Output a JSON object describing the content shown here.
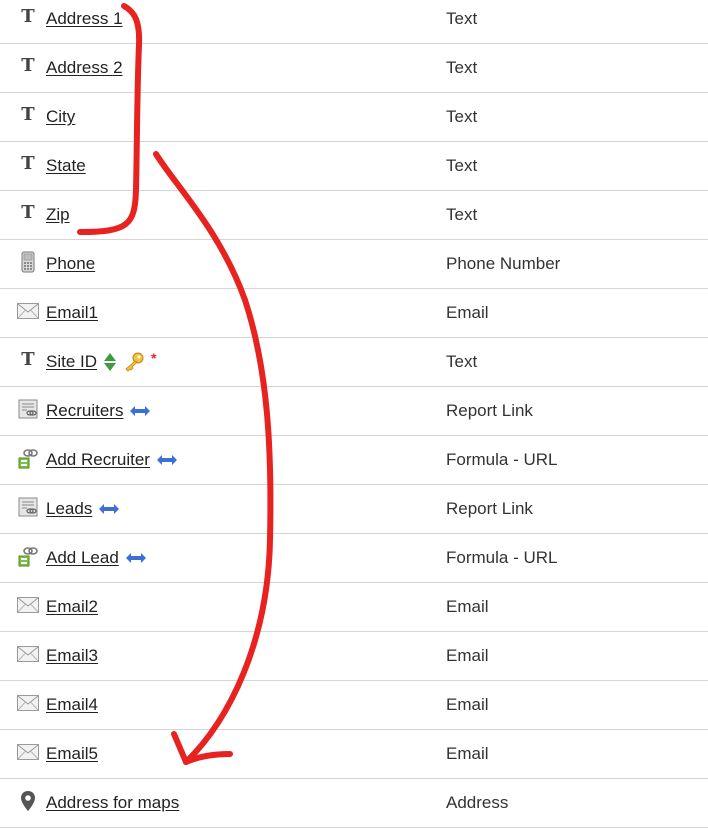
{
  "fields": [
    {
      "name": "Address 1",
      "type": "Text",
      "icon": "text-icon"
    },
    {
      "name": "Address 2",
      "type": "Text",
      "icon": "text-icon"
    },
    {
      "name": "City",
      "type": "Text",
      "icon": "text-icon"
    },
    {
      "name": "State",
      "type": "Text",
      "icon": "text-icon"
    },
    {
      "name": "Zip",
      "type": "Text",
      "icon": "text-icon"
    },
    {
      "name": "Phone",
      "type": "Phone Number",
      "icon": "phone-icon"
    },
    {
      "name": "Email1",
      "type": "Email",
      "icon": "email-icon"
    },
    {
      "name": "Site ID",
      "type": "Text",
      "icon": "text-icon",
      "badges": [
        "sort-icon",
        "key-icon",
        "required-star-icon"
      ]
    },
    {
      "name": "Recruiters",
      "type": "Report Link",
      "icon": "report-link-icon",
      "badges": [
        "two-way-link-icon"
      ]
    },
    {
      "name": "Add Recruiter",
      "type": "Formula - URL",
      "icon": "formula-url-icon",
      "badges": [
        "two-way-link-icon"
      ]
    },
    {
      "name": "Leads",
      "type": "Report Link",
      "icon": "report-link-icon",
      "badges": [
        "two-way-link-icon"
      ]
    },
    {
      "name": "Add Lead",
      "type": "Formula - URL",
      "icon": "formula-url-icon",
      "badges": [
        "two-way-link-icon"
      ]
    },
    {
      "name": "Email2",
      "type": "Email",
      "icon": "email-icon"
    },
    {
      "name": "Email3",
      "type": "Email",
      "icon": "email-icon"
    },
    {
      "name": "Email4",
      "type": "Email",
      "icon": "email-icon"
    },
    {
      "name": "Email5",
      "type": "Email",
      "icon": "email-icon"
    },
    {
      "name": "Address for maps",
      "type": "Address",
      "icon": "map-pin-icon"
    }
  ],
  "text_icon_glyph": "T",
  "required_mark": "*",
  "colors": {
    "annotation": "#e8231f",
    "link_arrow": "#3d6fd6",
    "divider": "#d6d6d6"
  }
}
